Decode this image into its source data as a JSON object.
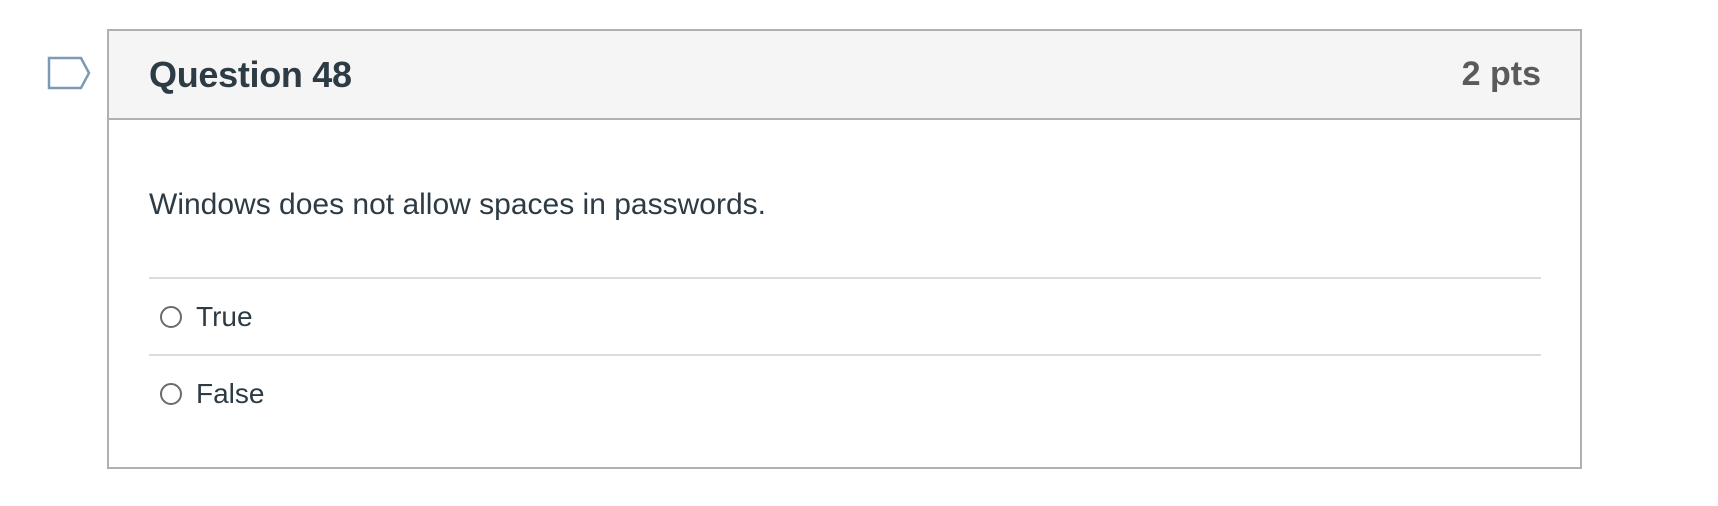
{
  "question": {
    "title": "Question 48",
    "points": "2 pts",
    "text": "Windows does not allow spaces in passwords.",
    "flag_icon": "flag-outline-icon",
    "answers": [
      {
        "label": "True",
        "selected": false
      },
      {
        "label": "False",
        "selected": false
      }
    ]
  },
  "colors": {
    "header_bg": "#f5f5f5",
    "border": "#b0b0b0",
    "text": "#2d3b45",
    "flag_outline": "#7a9ab5"
  }
}
